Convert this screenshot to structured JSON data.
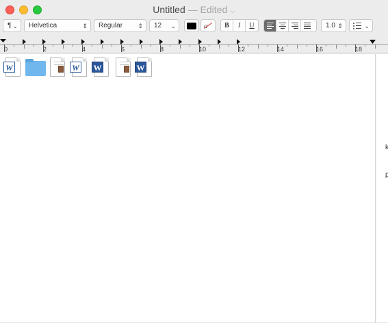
{
  "window": {
    "title": "Untitled",
    "edited_label": "— Edited",
    "title_chevron": "⌵"
  },
  "toolbar": {
    "paragraph_styles_icon": "¶",
    "font_family": "Helvetica",
    "font_typeface": "Regular",
    "font_size": "12",
    "bold_label": "B",
    "italic_label": "I",
    "underline_label": "U",
    "line_spacing": "1.0",
    "text_color": "#000000",
    "selected_alignment": "left"
  },
  "ruler": {
    "labels": [
      "0",
      "2",
      "4",
      "6",
      "8",
      "10",
      "12",
      "14",
      "16",
      "18"
    ]
  },
  "document": {
    "files": [
      {
        "kind": "word-doc",
        "badge": "W"
      },
      {
        "kind": "folder",
        "badge": ""
      },
      {
        "kind": "image-doc",
        "badge": ""
      },
      {
        "kind": "word-doc",
        "badge": "W"
      },
      {
        "kind": "word-doc",
        "badge": "W"
      },
      {
        "kind": "image-doc",
        "badge": ""
      },
      {
        "kind": "word-doc",
        "badge": "W"
      }
    ],
    "edge_fragments": [
      "k",
      "p"
    ]
  },
  "colors": {
    "accent_word": "#2b579a",
    "folder_blue": "#6fb7ec",
    "close": "#fe5f57",
    "minimize": "#febc2e",
    "zoom": "#28c840"
  }
}
